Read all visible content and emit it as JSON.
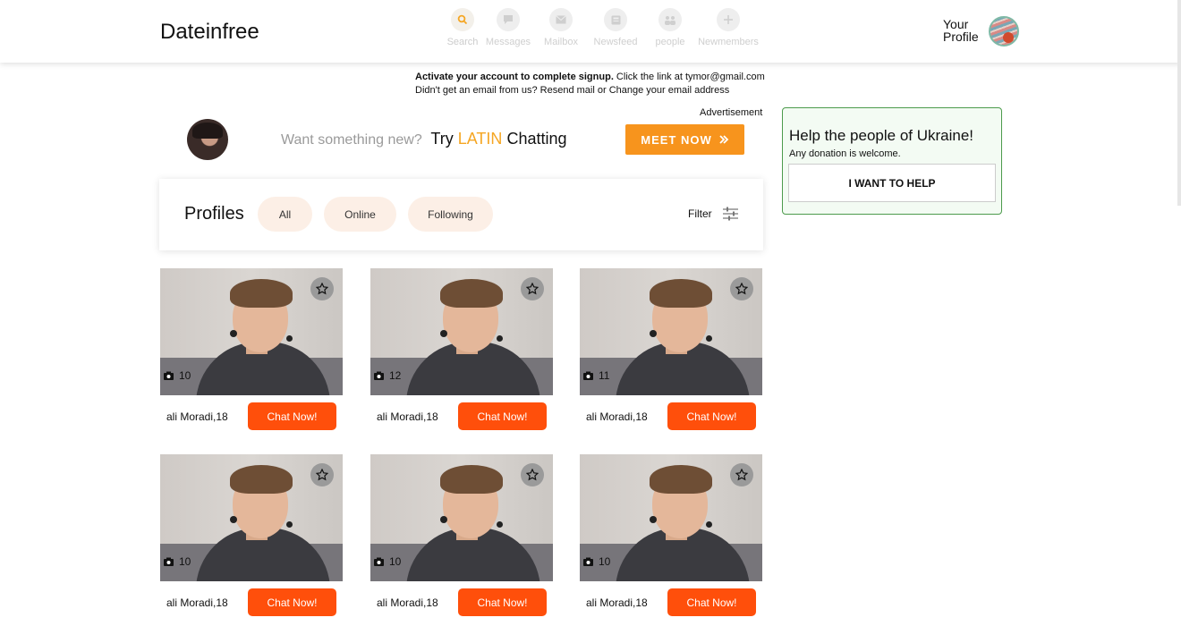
{
  "header": {
    "logo": "Dateinfree",
    "nav": [
      {
        "label": "Search",
        "icon": "search-icon"
      },
      {
        "label": "Messages",
        "icon": "chat-bubble-icon"
      },
      {
        "label": "Mailbox",
        "icon": "envelope-icon"
      },
      {
        "label": "Newsfeed",
        "icon": "newspaper-icon"
      },
      {
        "label": "people",
        "icon": "people-icon"
      },
      {
        "label": "Newmembers",
        "icon": "plus-icon"
      }
    ],
    "profile_label": "Your Profile"
  },
  "notice": {
    "bold": "Activate your account to complete signup.",
    "line1_rest": " Click the link at tymor@gmail.com",
    "line2": "Didn't get an email from us? Resend mail or Change your email address"
  },
  "ad": {
    "label": "Advertisement",
    "text_muted": "Want something new?",
    "text_try": "Try",
    "text_accent": "LATIN",
    "text_end": "Chatting",
    "button": "MEET NOW",
    "accent_color": "#f5a623",
    "button_color": "#f7941d"
  },
  "profiles": {
    "title": "Profiles",
    "tabs": [
      "All",
      "Online",
      "Following"
    ],
    "filter": "Filter"
  },
  "donation": {
    "title": "Help the people of Ukraine!",
    "subtitle": "Any donation is welcome.",
    "button": "I WANT TO HELP"
  },
  "cards": [
    {
      "name": "ali Moradi,18",
      "photos": "10",
      "button": "Chat Now!"
    },
    {
      "name": "ali Moradi,18",
      "photos": "12",
      "button": "Chat Now!"
    },
    {
      "name": "ali Moradi,18",
      "photos": "11",
      "button": "Chat Now!"
    },
    {
      "name": "ali Moradi,18",
      "photos": "10",
      "button": "Chat Now!"
    },
    {
      "name": "ali Moradi,18",
      "photos": "10",
      "button": "Chat Now!"
    },
    {
      "name": "ali Moradi,18",
      "photos": "10",
      "button": "Chat Now!"
    }
  ],
  "colors": {
    "chat_button": "#ff4f0b",
    "pill_bg": "#fcefe6",
    "donate_border": "#4c9b4c"
  }
}
